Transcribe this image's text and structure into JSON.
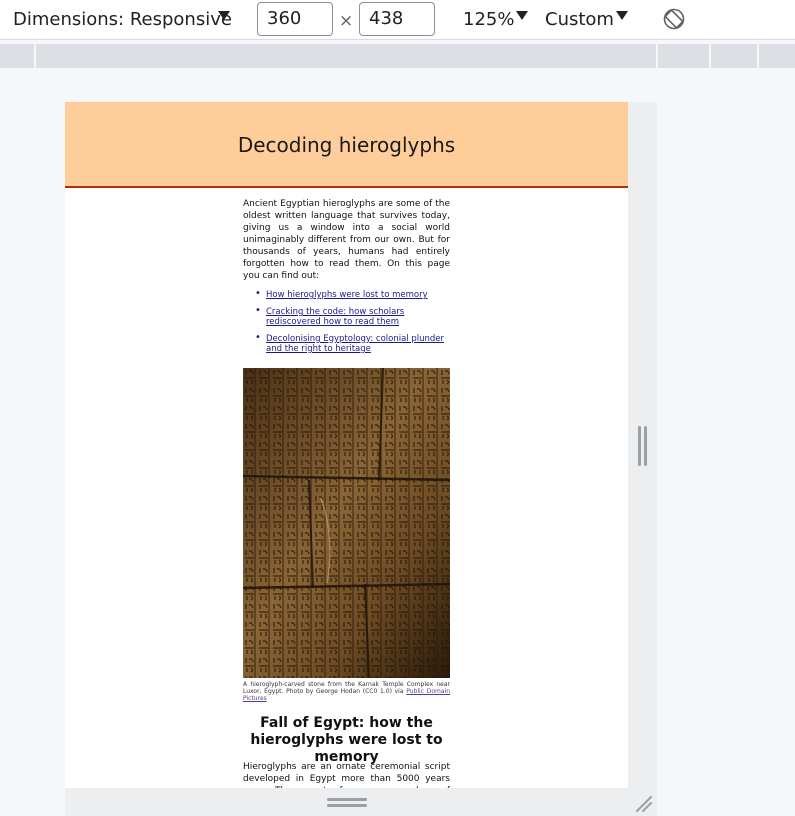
{
  "devtools": {
    "dimensions_label": "Dimensions: Responsive",
    "width": "360",
    "height": "438",
    "times": "×",
    "zoom": "125%",
    "throttle": "Custom"
  },
  "page": {
    "title": "Decoding hieroglyphs",
    "intro": "Ancient Egyptian hieroglyphs are some of the oldest written language that survives today, giving us a window into a social world unimaginably different from our own. But for thousands of years, humans had entirely forgotten how to read them. On this page you can find out:",
    "links": [
      "How hieroglyphs were lost to memory",
      "Cracking the code: how scholars rediscovered how to read them",
      "Decolonising Egyptology: colonial plunder and the right to heritage"
    ],
    "caption_text": "A hieroglyph-carved stone from the Karnak Temple Complex near Luxor, Egypt. Photo by George Hodan (CC0 1.0) via ",
    "caption_link": "Public Domain Pictures",
    "section_heading": "Fall of Egypt: how the hieroglyphs were lost to memory",
    "section_body": "Hieroglyphs are an ornate ceremonial script developed in Egypt more than 5000 years ago. The most famous examples of hieroglyphic text"
  },
  "colors": {
    "header_bg": "#ffcd99",
    "header_border": "#b22a10",
    "link": "#1a1a8c"
  }
}
